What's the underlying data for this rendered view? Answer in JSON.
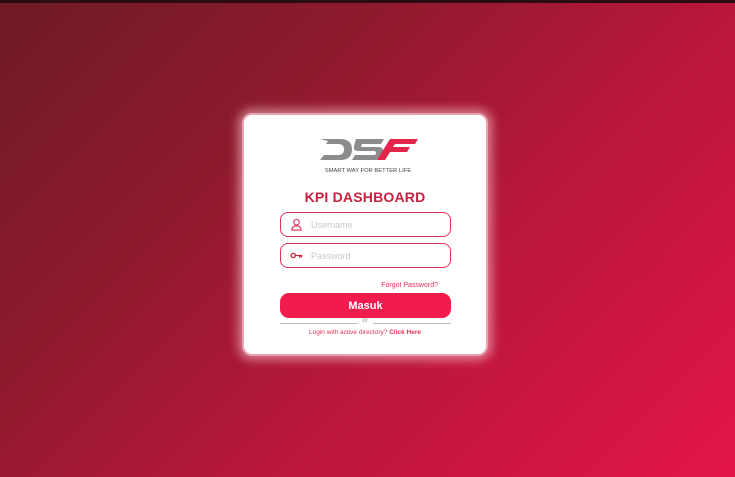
{
  "brand": {
    "logo_text": "DSF",
    "tagline": "SMART WAY FOR BETTER LIFE",
    "logo_colors": {
      "gray": "#8c8c8c",
      "red": "#e3254c"
    }
  },
  "page": {
    "title": "KPI DASHBOARD"
  },
  "form": {
    "username_placeholder": "Username",
    "password_placeholder": "Password",
    "username_icon": "user-icon",
    "password_icon": "key-icon",
    "forgot_label": "Forgot Password?",
    "submit_label": "Masuk",
    "or_label": "or",
    "ad_prompt": "Login with active directory?",
    "ad_link": "Click Here"
  },
  "colors": {
    "accent": "#f11c4d",
    "title": "#c8203e",
    "background_start": "#6e1a26",
    "background_end": "#e31548"
  }
}
